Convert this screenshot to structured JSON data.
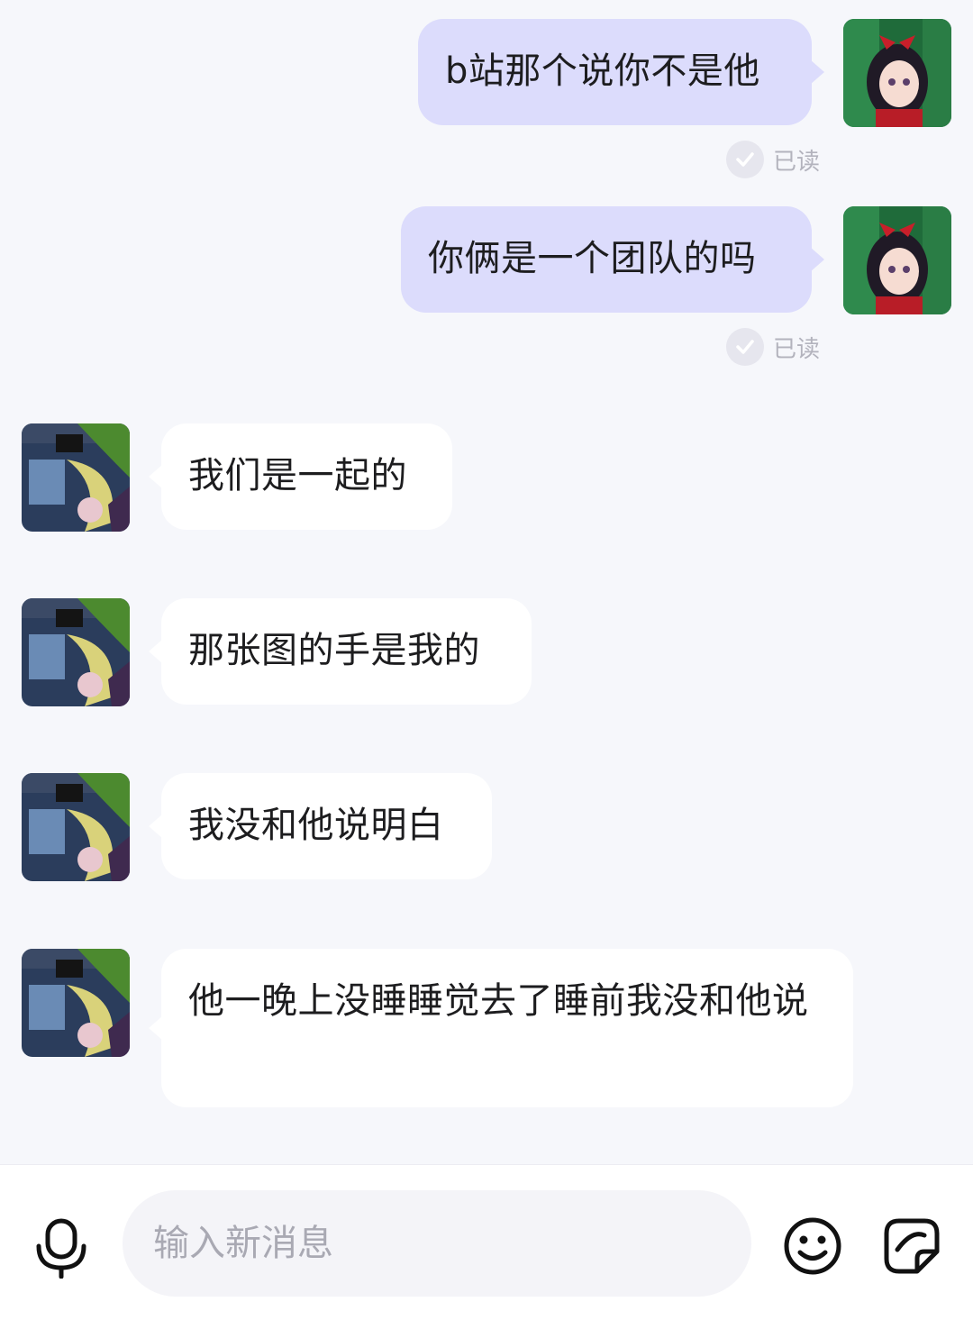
{
  "messages": [
    {
      "id": 1,
      "side": "me",
      "text": "b站那个说你不是他",
      "read_label": "已读"
    },
    {
      "id": 2,
      "side": "me",
      "text": "你俩是一个团队的吗",
      "read_label": "已读"
    },
    {
      "id": 3,
      "side": "them",
      "text": "我们是一起的"
    },
    {
      "id": 4,
      "side": "them",
      "text": "那张图的手是我的"
    },
    {
      "id": 5,
      "side": "them",
      "text": "我没和他说明白"
    },
    {
      "id": 6,
      "side": "them",
      "text": "他一晚上没睡睡觉去了睡前我没和他说"
    }
  ],
  "input": {
    "placeholder": "输入新消息",
    "value": ""
  },
  "icons": {
    "voice": "microphone-icon",
    "emoji": "smiley-face-icon",
    "sticker": "sticker-icon",
    "read": "check-circle-icon"
  },
  "colors": {
    "my_bubble": "#dcdcfc",
    "their_bubble": "#ffffff",
    "background": "#f6f7fb",
    "read_label": "#b3b3bd"
  }
}
